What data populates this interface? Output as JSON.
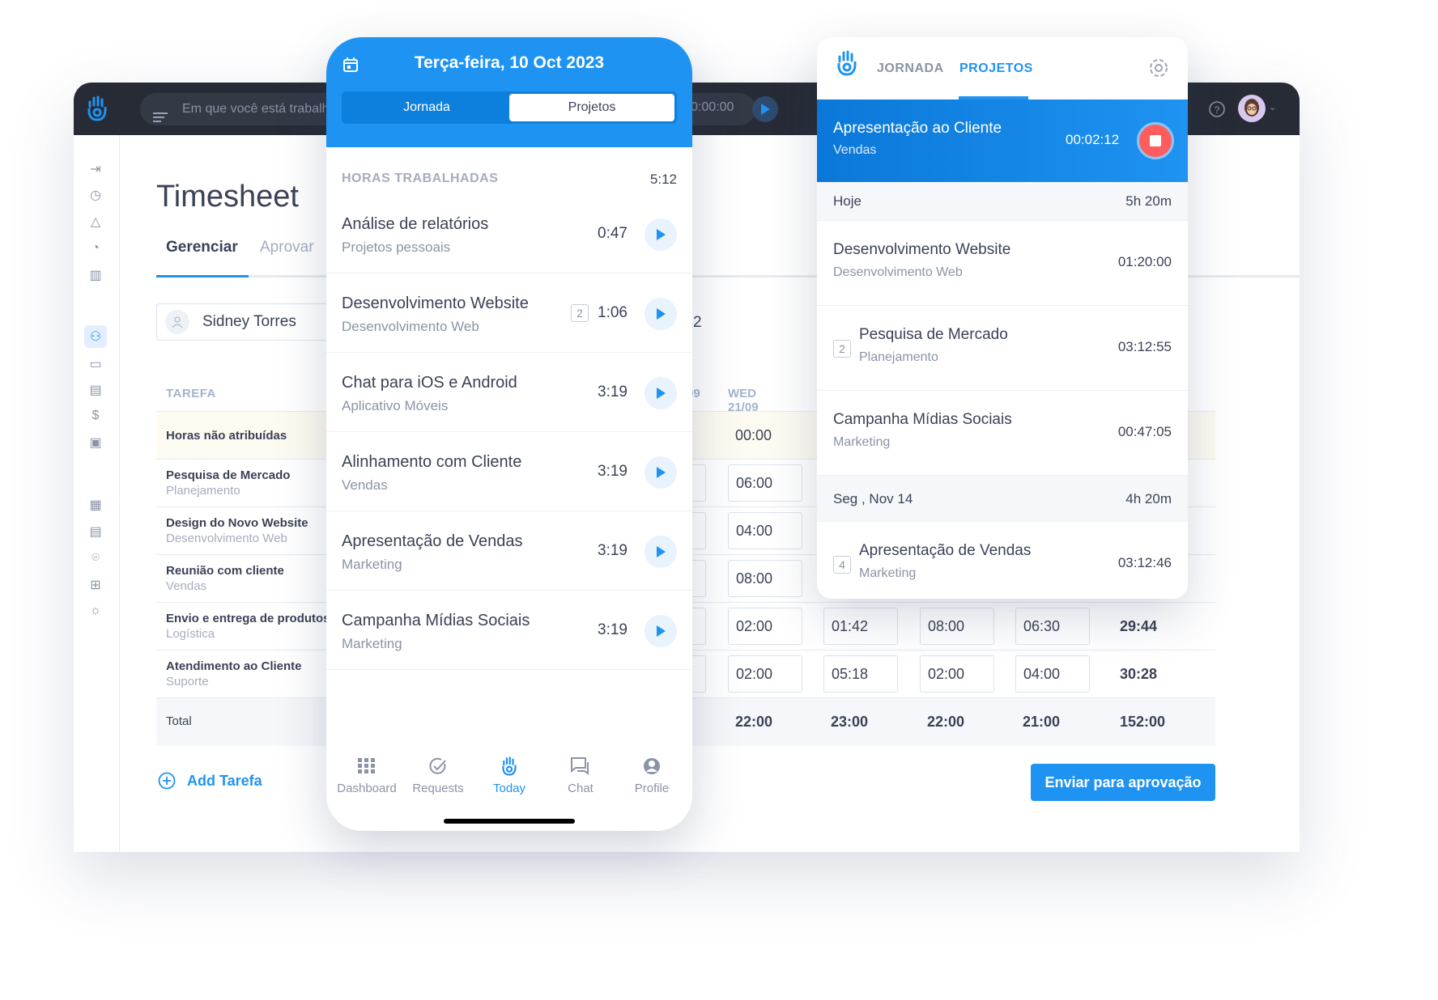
{
  "colors": {
    "accent": "#1f93f2",
    "header_dark": "#272b36",
    "stop": "#ff5d5d",
    "unassigned_row": "#fdfaf1"
  },
  "topbar": {
    "search_placeholder": "Em que você está trabalh",
    "timer": "0:00:00",
    "help_icon": "help-circle-icon",
    "avatar_icon": "avatar"
  },
  "sidebar": {
    "icons": [
      "sign-in-icon",
      "clock-icon",
      "mountain-icon",
      "pie-chart-icon",
      "bar-chart-icon",
      "users-icon",
      "folder-icon",
      "briefcase-icon",
      "dollar-icon",
      "cash-register-icon",
      "calendar-icon",
      "document-icon",
      "location-icon",
      "hierarchy-icon",
      "sun-icon"
    ],
    "active": "users-icon"
  },
  "timesheet": {
    "title": "Timesheet",
    "tabs": [
      "Gerenciar",
      "Aprovar"
    ],
    "active_tab": "Gerenciar",
    "user": "Sidney Torres",
    "partial_value": "2",
    "task_header": "TAREFA",
    "day_headers": [
      "09",
      "WED 21/09",
      "",
      "",
      ""
    ],
    "rows": [
      {
        "task": "Horas não atribuídas",
        "project": "",
        "cells": [
          "",
          "00:00",
          "",
          "",
          ""
        ],
        "total": ""
      },
      {
        "task": "Pesquisa de Mercado",
        "project": "Planejamento",
        "cells": [
          "",
          "06:00",
          "",
          "",
          ""
        ],
        "total": ""
      },
      {
        "task": "Design do Novo Website",
        "project": "Desenvolvimento Web",
        "cells": [
          "",
          "04:00",
          "",
          "",
          ""
        ],
        "total": ""
      },
      {
        "task": "Reunião com cliente",
        "project": "Vendas",
        "cells": [
          "",
          "08:00",
          "",
          "",
          ""
        ],
        "total": ""
      },
      {
        "task": "Envio e entrega de produtos",
        "project": "Logística",
        "cells": [
          "",
          "02:00",
          "01:42",
          "08:00",
          "06:30"
        ],
        "total": "29:44"
      },
      {
        "task": "Atendimento ao Cliente",
        "project": "Suporte",
        "cells": [
          "",
          "02:00",
          "05:18",
          "02:00",
          "04:00"
        ],
        "total": "30:28"
      }
    ],
    "total_label": "Total",
    "totals": [
      "",
      "22:00",
      "23:00",
      "22:00",
      "21:00"
    ],
    "grand_total": "152:00",
    "add_task": "Add Tarefa",
    "submit": "Enviar para aprovação"
  },
  "mobile": {
    "date": "Terça-feira, 10 Oct 2023",
    "segments": [
      "Jornada",
      "Projetos"
    ],
    "active_segment": "Projetos",
    "section_label": "HORAS TRABALHADAS",
    "section_total": "5:12",
    "items": [
      {
        "title": "Análise de relatórios",
        "sub": "Projetos pessoais",
        "badge": "",
        "time": "0:47"
      },
      {
        "title": "Desenvolvimento Website",
        "sub": "Desenvolvimento Web",
        "badge": "2",
        "time": "1:06"
      },
      {
        "title": "Chat para iOS e Android",
        "sub": "Aplicativo Móveis",
        "badge": "",
        "time": "3:19"
      },
      {
        "title": "Alinhamento com Cliente",
        "sub": "Vendas",
        "badge": "",
        "time": "3:19"
      },
      {
        "title": "Apresentação de Vendas",
        "sub": "Marketing",
        "badge": "",
        "time": "3:19"
      },
      {
        "title": "Campanha Mídias Sociais",
        "sub": "Marketing",
        "badge": "",
        "time": "3:19"
      }
    ],
    "nav": [
      {
        "label": "Dashboard",
        "icon": "grid-icon"
      },
      {
        "label": "Requests",
        "icon": "check-circle-icon"
      },
      {
        "label": "Today",
        "icon": "hand-logo-icon",
        "active": true
      },
      {
        "label": "Chat",
        "icon": "chat-icon"
      },
      {
        "label": "Profile",
        "icon": "profile-icon"
      }
    ]
  },
  "panel": {
    "tabs": [
      "JORNADA",
      "PROJETOS"
    ],
    "active_tab": "PROJETOS",
    "running": {
      "title": "Apresentação ao Cliente",
      "sub": "Vendas",
      "time": "00:02:12"
    },
    "groups": [
      {
        "label": "Hoje",
        "total": "5h 20m",
        "items": [
          {
            "title": "Desenvolvimento Website",
            "sub": "Desenvolvimento Web",
            "badge": "",
            "time": "01:20:00"
          },
          {
            "title": "Pesquisa de Mercado",
            "sub": "Planejamento",
            "badge": "2",
            "time": "03:12:55"
          },
          {
            "title": "Campanha Mídias Sociais",
            "sub": "Marketing",
            "badge": "",
            "time": "00:47:05"
          }
        ]
      },
      {
        "label": "Seg , Nov 14",
        "total": "4h 20m",
        "items": [
          {
            "title": "Apresentação de Vendas",
            "sub": "Marketing",
            "badge": "4",
            "time": "03:12:46"
          }
        ]
      }
    ]
  }
}
